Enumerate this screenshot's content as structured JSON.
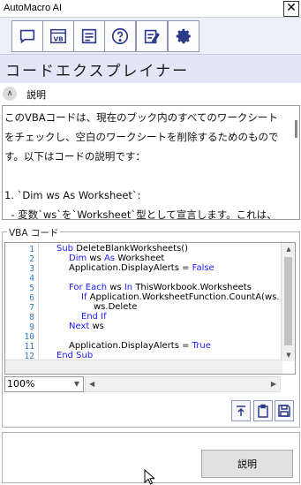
{
  "window": {
    "title": "AutoMacro AI",
    "close_glyph": "✕"
  },
  "toolbar": {
    "buttons": [
      "chat-icon",
      "vb-icon",
      "list-icon",
      "help-icon",
      "checklist-icon",
      "gear-icon"
    ],
    "vb_glyph": "VB"
  },
  "app_title": "コードエクスプレイナー",
  "explanation": {
    "header": "説明",
    "collapse_glyph": "∧",
    "text": "このVBAコードは、現在のブック内のすべてのワークシートをチェックし、空白のワークシートを削除するためのものです。以下はコードの説明です：\n\n1. `Dim ws As Worksheet`:\n  - 変数`ws`を`Worksheet`型として宣言します。これは、各ワークシートを順番に参照するために使用されます。"
  },
  "vba": {
    "legend": "VBA コード",
    "line_numbers": [
      "1",
      "2",
      "3",
      "4",
      "5",
      "6",
      "7",
      "8",
      "9",
      "10",
      "11",
      "12"
    ],
    "zoom": "100%"
  },
  "explain_button": "説明",
  "colors": {
    "keyword": "#1a1aff",
    "line_number": "#2b7bbf",
    "accent": "#2b3a8a",
    "title_bg": "#e4e6f7"
  }
}
